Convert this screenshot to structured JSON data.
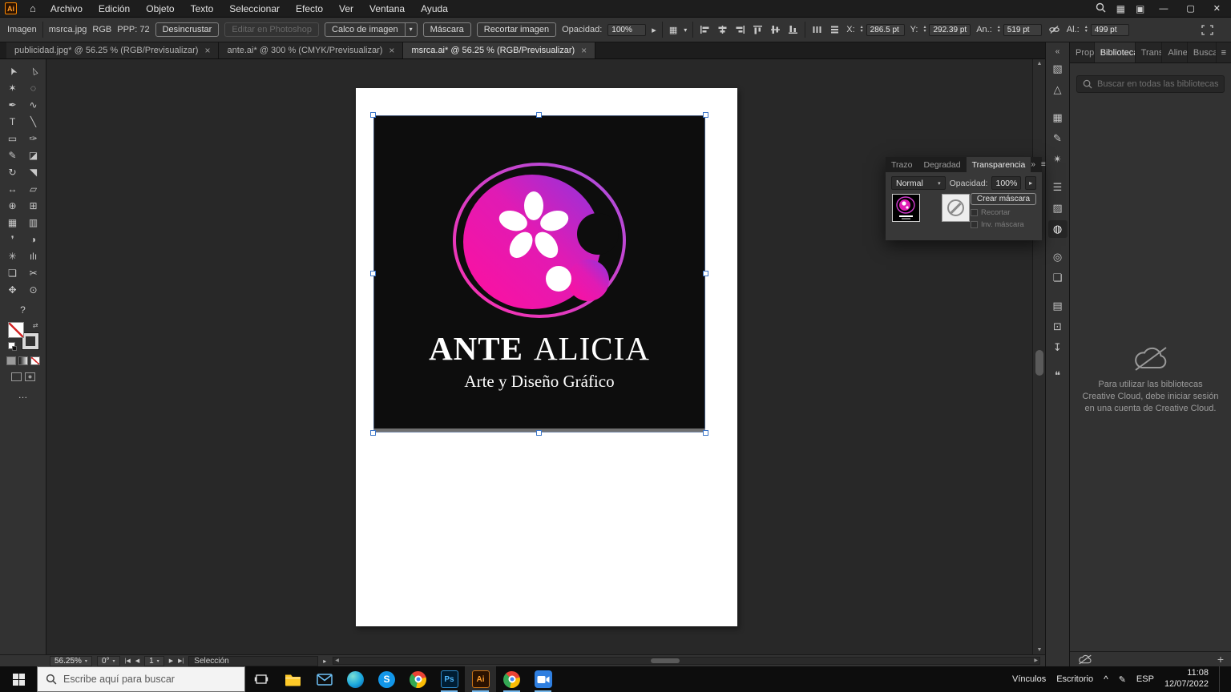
{
  "glyphs": {
    "home": "⌂",
    "chevron_down": "▾",
    "spin_up": "▴",
    "spin_down": "▾",
    "arrow_right": "▸",
    "panel_menu": "≡",
    "panel_more": "»",
    "collapse_dock": "«",
    "tab_close": "×",
    "win_min": "—",
    "win_restore": "▢",
    "win_close": "✕",
    "workspace_grid": "▦",
    "workspace_switch": "▣",
    "nav_first": "|◀",
    "nav_prev": "◀",
    "nav_next": "▶",
    "nav_last": "▶|",
    "scroll_up": "▲",
    "scroll_down": "▼",
    "scroll_left": "◀",
    "scroll_right": "▶",
    "ellipsis": "…",
    "plus": "+",
    "caret": "^",
    "pen_tray": "✎",
    "help": "?",
    "swap": "⇄"
  },
  "menubar": {
    "app_badge": "Ai",
    "menus": [
      "Archivo",
      "Edición",
      "Objeto",
      "Texto",
      "Seleccionar",
      "Efecto",
      "Ver",
      "Ventana",
      "Ayuda"
    ]
  },
  "controlbar": {
    "context_label": "Imagen",
    "file_name": "msrca.jpg",
    "color_mode": "RGB",
    "ppi": "PPP: 72",
    "embed_button": "Desincrustar",
    "edit_ps_button": "Editar en Photoshop",
    "trace_button": "Calco de imagen",
    "mask_button": "Máscara",
    "crop_button": "Recortar imagen",
    "opacity_label": "Opacidad:",
    "opacity_value": "100%",
    "x_label": "X:",
    "x_value": "286.5 pt",
    "y_label": "Y:",
    "y_value": "292.39 pt",
    "w_label": "An.:",
    "w_value": "519 pt",
    "h_label": "Al.:",
    "h_value": "499 pt"
  },
  "tabs": [
    {
      "label": "publicidad.jpg* @ 56.25 % (RGB/Previsualizar)"
    },
    {
      "label": "ante.ai* @ 300 % (CMYK/Previsualizar)"
    },
    {
      "label": "msrca.ai* @ 56.25 % (RGB/Previsualizar)"
    }
  ],
  "toolbar": {
    "tools": [
      {
        "name": "selection",
        "glyph": "➤"
      },
      {
        "name": "direct-selection",
        "glyph": "▻"
      },
      {
        "name": "magic-wand",
        "glyph": "✶"
      },
      {
        "name": "lasso",
        "glyph": "◌"
      },
      {
        "name": "pen",
        "glyph": "✒"
      },
      {
        "name": "curvature",
        "glyph": "∿"
      },
      {
        "name": "type",
        "glyph": "T"
      },
      {
        "name": "line-segment",
        "glyph": "╲"
      },
      {
        "name": "rectangle",
        "glyph": "▭"
      },
      {
        "name": "paintbrush",
        "glyph": "✑"
      },
      {
        "name": "pencil",
        "glyph": "✎"
      },
      {
        "name": "eraser",
        "glyph": "◪"
      },
      {
        "name": "rotate",
        "glyph": "↻"
      },
      {
        "name": "scale",
        "glyph": "◥"
      },
      {
        "name": "width",
        "glyph": "↔"
      },
      {
        "name": "free-transform",
        "glyph": "▱"
      },
      {
        "name": "shape-builder",
        "glyph": "⊕"
      },
      {
        "name": "perspective-grid",
        "glyph": "⊞"
      },
      {
        "name": "mesh",
        "glyph": "▦"
      },
      {
        "name": "gradient",
        "glyph": "▥"
      },
      {
        "name": "eyedropper",
        "glyph": "❜"
      },
      {
        "name": "blend",
        "glyph": "◑"
      },
      {
        "name": "symbol-sprayer",
        "glyph": "✳"
      },
      {
        "name": "column-graph",
        "glyph": "ılı"
      },
      {
        "name": "artboard",
        "glyph": "❏"
      },
      {
        "name": "slice",
        "glyph": "✂"
      },
      {
        "name": "hand",
        "glyph": "✥"
      },
      {
        "name": "zoom",
        "glyph": "⊙"
      }
    ]
  },
  "artwork": {
    "title_bold": "ANTE",
    "title_light": "ALICIA",
    "subtitle": "Arte y Diseño Gráfico"
  },
  "transparency_panel": {
    "tab_stroke": "Trazo",
    "tab_gradient": "Degradad",
    "tab_transparency": "Transparencia",
    "blend_mode": "Normal",
    "opacity_label": "Opacidad:",
    "opacity_value": "100%",
    "make_mask_button": "Crear máscara",
    "clip_label": "Recortar",
    "invert_label": "Inv. máscara"
  },
  "dock": {
    "icons": [
      {
        "name": "color",
        "glyph": "▧"
      },
      {
        "name": "color-guide",
        "glyph": "△"
      },
      {
        "name": "swatches",
        "glyph": "▦"
      },
      {
        "name": "brushes",
        "glyph": "✎"
      },
      {
        "name": "symbols",
        "glyph": "✴"
      },
      {
        "name": "stroke",
        "glyph": "☰"
      },
      {
        "name": "gradient",
        "glyph": "▨"
      },
      {
        "name": "transparency",
        "glyph": "◍"
      },
      {
        "name": "appearance",
        "glyph": "◎"
      },
      {
        "name": "graphic-styles",
        "glyph": "❏"
      },
      {
        "name": "layers",
        "glyph": "▤"
      },
      {
        "name": "artboards",
        "glyph": "⊡"
      },
      {
        "name": "asset-export",
        "glyph": "↧"
      },
      {
        "name": "comments",
        "glyph": "❝"
      }
    ]
  },
  "libraries": {
    "tab_prop": "Prop",
    "tab_libraries": "Bibliotecas",
    "tab_trans": "Trans",
    "tab_align": "Aline",
    "tab_search": "Busca",
    "search_placeholder": "Buscar en todas las bibliotecas",
    "message": "Para utilizar las bibliotecas Creative Cloud, debe iniciar sesión en una cuenta de Creative Cloud."
  },
  "statusbar": {
    "zoom": "56.25%",
    "rotation": "0°",
    "artboard_number": "1",
    "status": "Selección"
  },
  "taskbar": {
    "search_placeholder": "Escribe aquí para buscar",
    "badges": {
      "skype": "S",
      "photoshop": "Ps",
      "illustrator": "Ai"
    },
    "tray": {
      "links": "Vínculos",
      "desktop": "Escritorio",
      "lang": "ESP",
      "time": "11:08",
      "date": "12/07/2022"
    }
  }
}
